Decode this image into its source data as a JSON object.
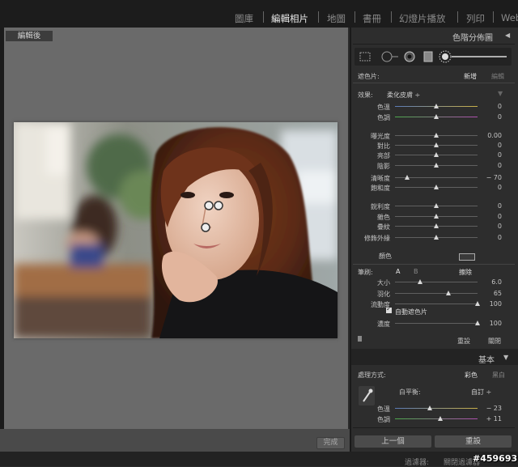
{
  "modules": [
    {
      "label": "圖庫",
      "active": false
    },
    {
      "label": "編輯相片",
      "active": true
    },
    {
      "label": "地圖",
      "active": false
    },
    {
      "label": "書冊",
      "active": false
    },
    {
      "label": "幻燈片播放",
      "active": false
    },
    {
      "label": "列印",
      "active": false
    },
    {
      "label": "Web",
      "active": false
    }
  ],
  "viewer": {
    "label": "編輯後",
    "done_label": "完成"
  },
  "histogram_panel": {
    "title": "色階分佈圖"
  },
  "brush_panel": {
    "mask_label": "遮色片:",
    "new_label": "新增",
    "edit_label": "編輯",
    "effect_label": "效果:",
    "effect_value": "柔化皮膚",
    "sliders": [
      {
        "label": "色溫",
        "value": "0",
        "pos": 0.5,
        "gradient": "temp"
      },
      {
        "label": "色調",
        "value": "0",
        "pos": 0.5,
        "gradient": "tint"
      },
      {
        "label": "曝光度",
        "value": "0.00",
        "pos": 0.5
      },
      {
        "label": "對比",
        "value": "0",
        "pos": 0.5
      },
      {
        "label": "亮部",
        "value": "0",
        "pos": 0.5
      },
      {
        "label": "陰影",
        "value": "0",
        "pos": 0.5
      },
      {
        "label": "清晰度",
        "value": "− 70",
        "pos": 0.15
      },
      {
        "label": "飽和度",
        "value": "0",
        "pos": 0.5
      },
      {
        "label": "銳利度",
        "value": "0",
        "pos": 0.5
      },
      {
        "label": "雜色",
        "value": "0",
        "pos": 0.5
      },
      {
        "label": "疊紋",
        "value": "0",
        "pos": 0.5
      },
      {
        "label": "修飾外緣",
        "value": "0",
        "pos": 0.5
      }
    ],
    "color_label": "顏色",
    "brush_label": "筆刷:",
    "brush_a": "A",
    "brush_b": "B",
    "erase_label": "擦除",
    "brush_sliders": [
      {
        "label": "大小",
        "value": "6.0",
        "pos": 0.3
      },
      {
        "label": "羽化",
        "value": "65",
        "pos": 0.65
      },
      {
        "label": "流動度",
        "value": "100",
        "pos": 1.0
      }
    ],
    "auto_mask_label": "自動遮色片",
    "auto_mask_checked": true,
    "density_label": "濃度",
    "density_value": "100",
    "density_pos": 1.0,
    "reset_label": "重設",
    "close_label": "關閉"
  },
  "basic_panel": {
    "title": "基本",
    "treatment_label": "處理方式:",
    "color_option": "彩色",
    "bw_option": "黑白",
    "wb_label": "白平衡:",
    "wb_value": "自訂",
    "sliders": [
      {
        "label": "色溫",
        "value": "− 23",
        "pos": 0.42,
        "gradient": "temp"
      },
      {
        "label": "色調",
        "value": "+ 11",
        "pos": 0.55,
        "gradient": "tint"
      }
    ]
  },
  "footer": {
    "prev_label": "上一個",
    "reset_label": "重設",
    "filter_label": "過濾器:",
    "filter_value": "關閉過濾器",
    "watermark": "#459693"
  },
  "colors": {
    "accent": "#e8e8e8",
    "panel": "#2d2d2d",
    "canvas": "#6a6a6a"
  }
}
